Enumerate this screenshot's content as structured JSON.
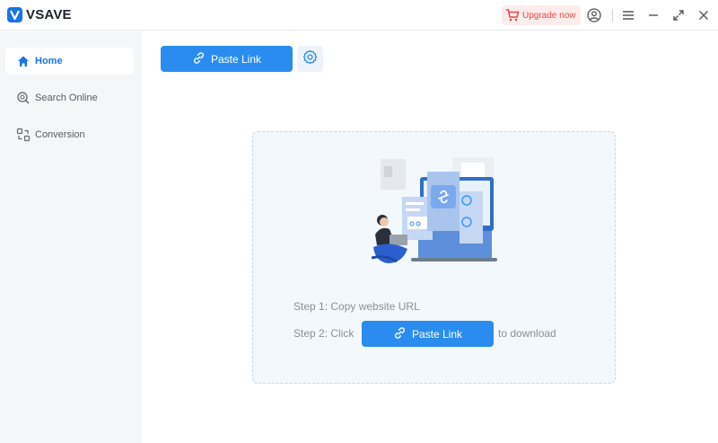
{
  "app": {
    "name": "VSAVE"
  },
  "titlebar": {
    "upgrade_label": "Upgrade now",
    "icons": [
      "cart-icon",
      "account-icon",
      "menu-icon",
      "minimize-icon",
      "maximize-icon",
      "close-icon"
    ]
  },
  "sidebar": {
    "items": [
      {
        "label": "Home",
        "icon": "home-icon",
        "active": true
      },
      {
        "label": "Search Online",
        "icon": "search-online-icon",
        "active": false
      },
      {
        "label": "Conversion",
        "icon": "conversion-icon",
        "active": false
      }
    ]
  },
  "toolbar": {
    "paste_label": "Paste Link",
    "settings_icon": "gear-icon"
  },
  "main": {
    "step1": "Step 1: Copy website URL",
    "step2_prefix": "Step 2: Click",
    "step2_button": "Paste Link",
    "step2_suffix": "to download"
  },
  "colors": {
    "accent": "#2b8cf0",
    "upgrade_bg": "#fdecec",
    "upgrade_text": "#e84848",
    "sidebar_bg": "#f5f6f8"
  }
}
